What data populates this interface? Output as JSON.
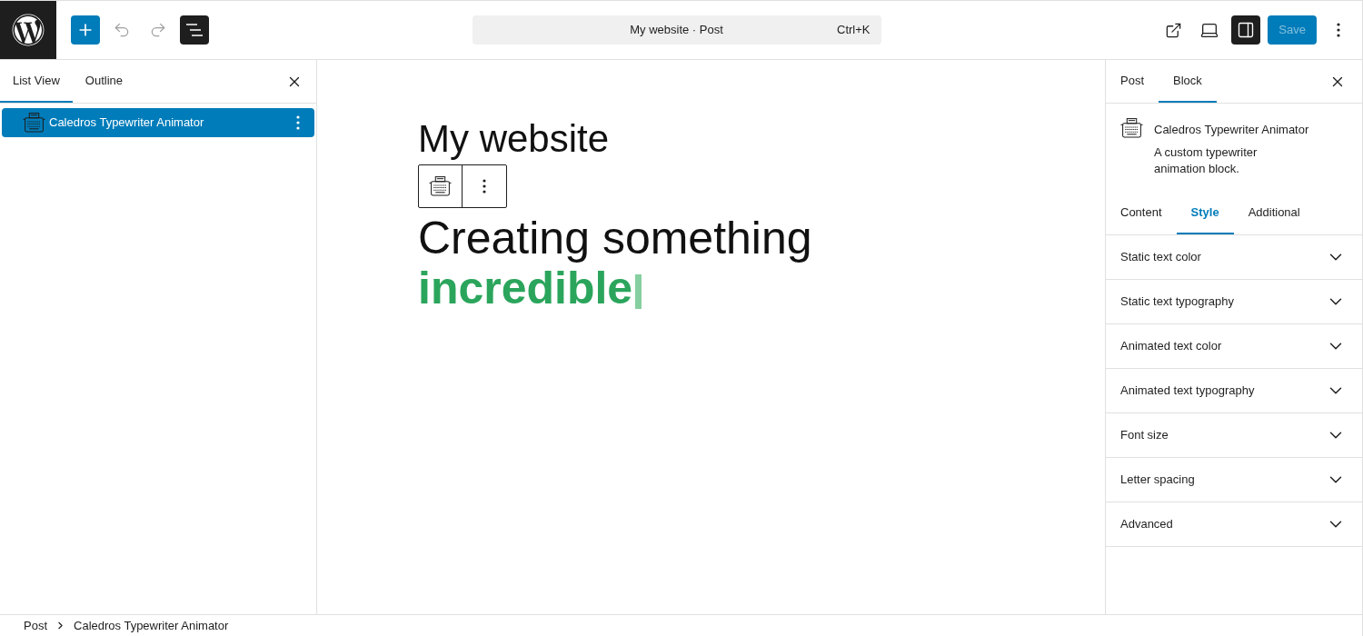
{
  "toolbar": {
    "undo": {
      "disabled": true
    },
    "redo": {
      "disabled": true
    },
    "document_overview": {
      "pressed": true
    }
  },
  "command_bar": {
    "title": "My website · Post",
    "shortcut": "Ctrl+K"
  },
  "actions": {
    "settings": {
      "pressed": true
    },
    "save": {
      "label": "Save",
      "disabled": true
    }
  },
  "list_panel": {
    "tabs": [
      {
        "label": "List View",
        "selected": true
      },
      {
        "label": "Outline",
        "selected": false
      }
    ],
    "items": [
      {
        "label": "Caledros Typewriter Animator",
        "selected": true
      }
    ]
  },
  "canvas": {
    "site_title": "My website",
    "static_text": "Creating something",
    "animated_text": "incredible"
  },
  "settings_panel": {
    "tabs": [
      {
        "label": "Post",
        "selected": false
      },
      {
        "label": "Block",
        "selected": true
      }
    ],
    "block": {
      "title": "Caledros Typewriter Animator",
      "description": "A custom typewriter animation block."
    },
    "inspector_tabs": [
      {
        "label": "Content",
        "selected": false
      },
      {
        "label": "Style",
        "selected": true
      },
      {
        "label": "Additional",
        "selected": false
      }
    ],
    "sections": [
      {
        "title": "Static text color",
        "expanded": false
      },
      {
        "title": "Static text typography",
        "expanded": false
      },
      {
        "title": "Animated text color",
        "expanded": false
      },
      {
        "title": "Animated text typography",
        "expanded": false
      },
      {
        "title": "Font size",
        "expanded": false
      },
      {
        "title": "Letter spacing",
        "expanded": false
      },
      {
        "title": "Advanced",
        "expanded": false
      }
    ]
  },
  "breadcrumb": [
    "Post",
    "Caledros Typewriter Animator"
  ]
}
